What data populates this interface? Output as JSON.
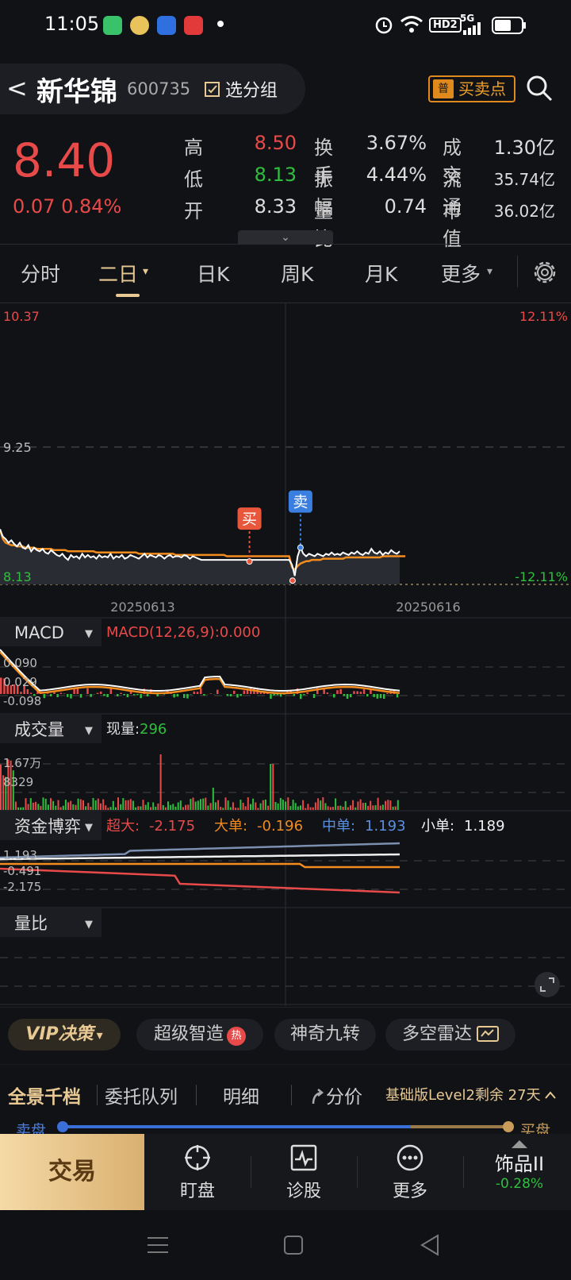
{
  "status_bar": {
    "time": "11:05",
    "network": "5G",
    "hd": "HD2"
  },
  "header": {
    "back": "<",
    "name": "新华锦",
    "code": "600735",
    "group_btn": "选分组",
    "buysell_badge": "普",
    "buysell_btn": "买卖点"
  },
  "quote": {
    "price": "8.40",
    "change": "0.07 0.84%",
    "rows": [
      {
        "l1": "高",
        "v1": "8.50",
        "l2": "换手",
        "v2": "3.67%",
        "l3": "成交",
        "v3": "1.30亿"
      },
      {
        "l1": "低",
        "v1": "8.13",
        "l2": "振幅",
        "v2": "4.44%",
        "l3": "流通",
        "v3": "35.74亿"
      },
      {
        "l1": "开",
        "v1": "8.33",
        "l2": "量比",
        "v2": "0.74",
        "l3": "市值",
        "v3": "36.02亿"
      }
    ]
  },
  "tabs": {
    "items": [
      "分时",
      "二日",
      "日K",
      "周K",
      "月K",
      "更多"
    ],
    "active": "二日",
    "arrow": "▾"
  },
  "chart_data": [
    {
      "type": "line",
      "name_cn": "two-day price",
      "y_top_left": "10.37",
      "y_mid_left": "9.25",
      "y_bottom_left": "8.13",
      "y_top_right": "12.11%",
      "y_bottom_right": "-12.11%",
      "x_labels": [
        "20250613",
        "20250616"
      ],
      "ylim": [
        8.13,
        10.37
      ],
      "markers": [
        {
          "label": "买",
          "x_index": 88,
          "y": 8.33
        },
        {
          "label": "卖",
          "x_index": 106,
          "y": 8.43
        }
      ],
      "price_series": [
        8.58,
        8.52,
        8.5,
        8.47,
        8.49,
        8.46,
        8.44,
        8.47,
        8.43,
        8.42,
        8.45,
        8.4,
        8.43,
        8.41,
        8.4,
        8.42,
        8.39,
        8.38,
        8.41,
        8.39,
        8.37,
        8.36,
        8.38,
        8.35,
        8.33,
        8.37,
        8.35,
        8.36,
        8.34,
        8.38,
        8.35,
        8.37,
        8.35,
        8.36,
        8.34,
        8.37,
        8.35,
        8.36,
        8.35,
        8.38,
        8.34,
        8.36,
        8.35,
        8.37,
        8.34,
        8.35,
        8.37,
        8.36,
        8.35,
        8.34,
        8.36,
        8.38,
        8.35,
        8.37,
        8.36,
        8.35,
        8.37,
        8.36,
        8.34,
        8.36,
        8.37,
        8.35,
        8.36,
        8.36,
        8.35,
        8.37,
        8.36,
        8.34,
        8.36,
        8.35,
        8.34,
        8.33,
        8.33,
        8.33,
        8.33,
        8.33,
        8.33,
        8.33,
        8.33,
        8.33,
        8.33,
        8.33,
        8.33,
        8.33,
        8.33,
        8.33,
        8.33,
        8.33,
        8.33,
        8.33,
        8.33,
        8.33,
        8.33,
        8.33,
        8.33,
        8.33,
        8.33,
        8.33,
        8.33,
        8.33,
        8.33,
        8.33,
        8.33,
        8.29,
        8.2,
        8.36,
        8.43,
        8.38,
        8.36,
        8.38,
        8.37,
        8.36,
        8.38,
        8.37,
        8.36,
        8.38,
        8.37,
        8.39,
        8.37,
        8.38,
        8.37,
        8.39,
        8.38,
        8.37,
        8.39,
        8.38,
        8.4,
        8.38,
        8.37,
        8.39,
        8.38,
        8.42,
        8.39,
        8.38,
        8.4,
        8.37,
        8.39,
        8.38,
        8.41,
        8.39,
        8.38,
        8.4
      ],
      "avg_series": [
        8.58,
        8.5,
        8.47,
        8.46,
        8.45,
        8.45,
        8.44,
        8.44,
        8.44,
        8.43,
        8.43,
        8.43,
        8.43,
        8.42,
        8.42,
        8.42,
        8.42,
        8.42,
        8.42,
        8.41,
        8.41,
        8.41,
        8.41,
        8.41,
        8.4,
        8.4,
        8.4,
        8.4,
        8.4,
        8.4,
        8.4,
        8.4,
        8.4,
        8.4,
        8.39,
        8.39,
        8.39,
        8.39,
        8.39,
        8.39,
        8.39,
        8.39,
        8.39,
        8.39,
        8.39,
        8.39,
        8.39,
        8.39,
        8.39,
        8.38,
        8.38,
        8.38,
        8.38,
        8.38,
        8.38,
        8.38,
        8.38,
        8.38,
        8.38,
        8.38,
        8.38,
        8.38,
        8.37,
        8.37,
        8.37,
        8.37,
        8.37,
        8.37,
        8.37,
        8.37,
        8.37,
        8.37,
        8.37,
        8.37,
        8.37,
        8.37,
        8.37,
        8.37,
        8.37,
        8.37,
        8.36,
        8.36,
        8.36,
        8.36,
        8.36,
        8.36,
        8.36,
        8.36,
        8.36,
        8.36,
        8.36,
        8.36,
        8.36,
        8.36,
        8.36,
        8.36,
        8.36,
        8.36,
        8.36,
        8.36,
        8.36,
        8.36,
        8.36,
        8.27,
        8.25,
        8.28,
        8.3,
        8.31,
        8.32,
        8.32,
        8.33,
        8.33,
        8.33,
        8.33,
        8.34,
        8.34,
        8.34,
        8.34,
        8.34,
        8.34,
        8.34,
        8.34,
        8.35,
        8.35,
        8.35,
        8.35,
        8.35,
        8.35,
        8.35,
        8.35,
        8.35,
        8.35,
        8.35,
        8.35,
        8.35,
        8.36,
        8.36,
        8.36,
        8.36,
        8.36,
        8.36,
        8.36,
        8.36,
        8.36
      ]
    },
    {
      "type": "line",
      "name_cn": "MACD",
      "label": "MACD",
      "params": "MACD(12,26,9):0.000",
      "y_labels": [
        "0.090",
        "0.029",
        "-0.098"
      ]
    },
    {
      "type": "bar",
      "name_cn": "volume",
      "label": "成交量",
      "current_label": "现量:",
      "current_value": "296",
      "y_labels": [
        "1.67万",
        "8329"
      ]
    },
    {
      "type": "line",
      "name_cn": "capital game",
      "label": "资金博弈",
      "y_labels": [
        "1.193",
        "-0.491",
        "-2.175"
      ],
      "legend": [
        {
          "name": "超大:",
          "value": "-2.175",
          "color": "#e84a4a"
        },
        {
          "name": "大单:",
          "value": "-0.196",
          "color": "#f28c1e"
        },
        {
          "name": "中单:",
          "value": "1.193",
          "color": "#5b8fe0"
        },
        {
          "name": "小单:",
          "value": "1.189",
          "color": "#f0f0f0"
        }
      ]
    },
    {
      "type": "line",
      "name_cn": "volume ratio",
      "label": "量比"
    }
  ],
  "strategy_bar": {
    "vip": "VIP决策",
    "vip_arrow": "▾",
    "items": [
      "超级智造",
      "神奇九转",
      "多空雷达"
    ],
    "hot_badge": "热"
  },
  "lower_tabs": {
    "items": [
      "全景千档",
      "委托队列",
      "明细",
      "分价"
    ],
    "level2": "基础版Level2剩余 27天",
    "sell_side": "卖盘",
    "buy_side": "买盘"
  },
  "bottom_nav": {
    "trade": "交易",
    "items": [
      "盯盘",
      "诊股",
      "更多"
    ],
    "sector": "饰品II",
    "sector_change": "-0.28%"
  },
  "colors": {
    "up": "#e84a4a",
    "down": "#2fbf3f",
    "accent": "#e8c994",
    "avg_line": "#f28c1e"
  }
}
